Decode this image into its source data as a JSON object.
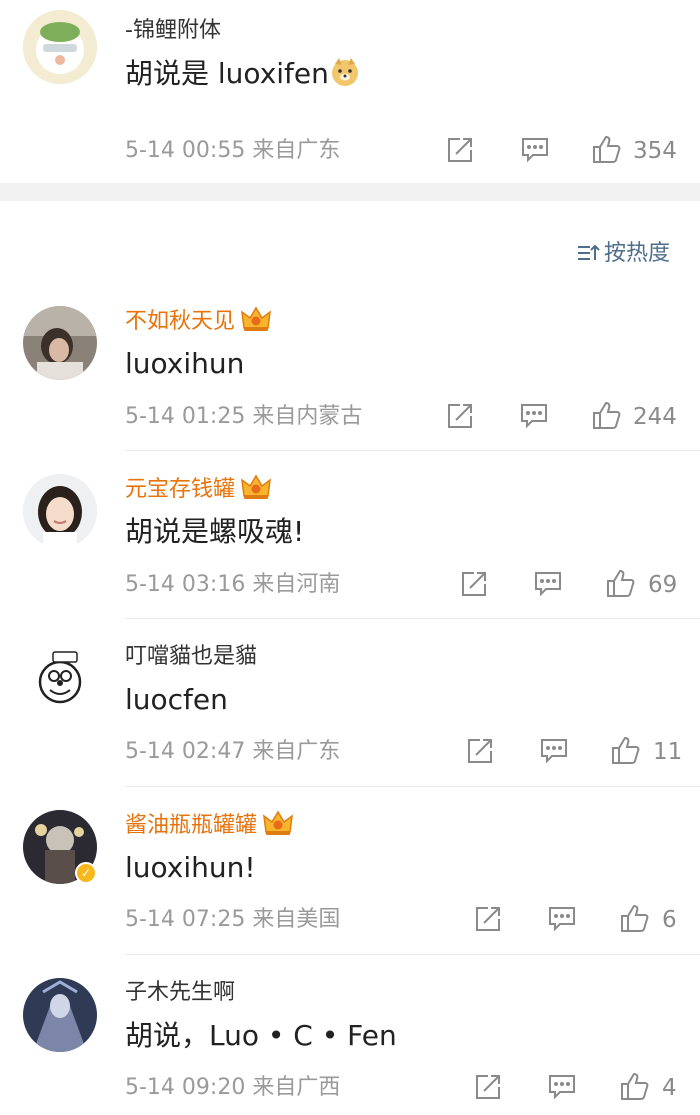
{
  "sort_label": "按热度",
  "comments": [
    {
      "name": "-锦鲤附体",
      "vip": false,
      "text": "胡说是 luoxifen",
      "time": "5-14 00:55",
      "location": "来自广东",
      "likes": "354"
    },
    {
      "name": "不如秋天见",
      "vip": true,
      "text": "luoxihun",
      "time": "5-14 01:25",
      "location": "来自内蒙古",
      "likes": "244"
    },
    {
      "name": "元宝存钱罐",
      "vip": true,
      "text": "胡说是螺吸魂!",
      "time": "5-14 03:16",
      "location": "来自河南",
      "likes": "69"
    },
    {
      "name": "叮噹貓也是貓",
      "vip": false,
      "text": "luocfen",
      "time": "5-14 02:47",
      "location": "来自广东",
      "likes": "11"
    },
    {
      "name": "酱油瓶瓶罐罐",
      "vip": true,
      "text": "luoxihun!",
      "time": "5-14 07:25",
      "location": "来自美国",
      "likes": "6"
    },
    {
      "name": "子木先生啊",
      "vip": false,
      "text": "胡说，Luo • C • Fen",
      "time": "5-14 09:20",
      "location": "来自广西",
      "likes": "4"
    }
  ]
}
